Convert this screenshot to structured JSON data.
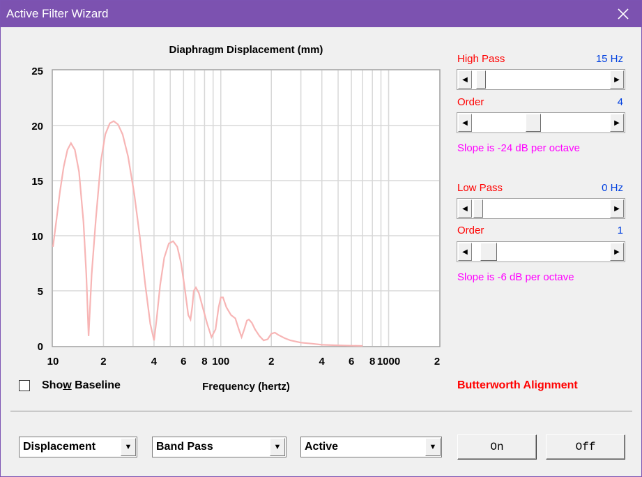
{
  "window": {
    "title": "Active Filter Wizard"
  },
  "chart_data": {
    "type": "line",
    "title": "Diaphragm Displacement (mm)",
    "xlabel": "Frequency (hertz)",
    "ylabel": "",
    "x_scale": "log",
    "xlim": [
      10,
      2000
    ],
    "ylim": [
      0,
      25
    ],
    "y_ticks": [
      0,
      5,
      10,
      15,
      20,
      25
    ],
    "x_tick_labels": [
      {
        "value": 10,
        "label": "10"
      },
      {
        "value": 20,
        "label": "2"
      },
      {
        "value": 40,
        "label": "4"
      },
      {
        "value": 60,
        "label": "6"
      },
      {
        "value": 80,
        "label": "8"
      },
      {
        "value": 100,
        "label": "100"
      },
      {
        "value": 200,
        "label": "2"
      },
      {
        "value": 400,
        "label": "4"
      },
      {
        "value": 600,
        "label": "6"
      },
      {
        "value": 800,
        "label": "8"
      },
      {
        "value": 1000,
        "label": "1000"
      },
      {
        "value": 2000,
        "label": "2"
      }
    ],
    "grid": true,
    "series": [
      {
        "color": "#f7b5b5",
        "x": [
          10,
          10.5,
          11,
          11.6,
          12.2,
          12.8,
          13.5,
          14.3,
          15.2,
          15.8,
          16.3,
          17,
          18,
          19.3,
          20.5,
          21.8,
          23,
          24.4,
          26,
          28,
          30.5,
          33,
          35.5,
          38,
          40,
          41.5,
          43.5,
          46,
          49,
          52,
          55,
          58,
          61,
          64,
          66,
          67.5,
          69,
          71,
          74,
          78,
          83,
          88,
          93,
          97,
          100,
          103,
          108,
          115,
          122,
          128,
          133,
          138,
          143,
          147,
          153,
          160,
          170,
          180,
          190,
          200,
          210,
          220,
          240,
          260,
          300,
          350,
          400,
          500,
          600,
          700
        ],
        "y": [
          9,
          11.5,
          14,
          16.3,
          17.8,
          18.4,
          17.8,
          15.8,
          11.2,
          6.5,
          0.9,
          6.5,
          11.5,
          16.8,
          19.2,
          20.2,
          20.4,
          20.1,
          19.2,
          17.2,
          13.8,
          9.8,
          5.5,
          2,
          0.5,
          2.5,
          5.5,
          8,
          9.3,
          9.5,
          9,
          7.5,
          5.2,
          2.8,
          2.4,
          3.5,
          5,
          5.3,
          4.8,
          3.5,
          2,
          0.8,
          1.5,
          3.5,
          4.4,
          4.4,
          3.5,
          2.8,
          2.5,
          1.5,
          0.8,
          1.5,
          2.3,
          2.4,
          2.1,
          1.5,
          0.9,
          0.5,
          0.6,
          1.1,
          1.2,
          1,
          0.7,
          0.5,
          0.3,
          0.2,
          0.1,
          0.05,
          0.02,
          0
        ]
      }
    ]
  },
  "high_pass": {
    "label": "High Pass",
    "value": "15 Hz",
    "position": 0.03
  },
  "high_pass_order": {
    "label": "Order",
    "value": "4",
    "position": 0.43
  },
  "high_slope": "Slope is -24 dB per octave",
  "low_pass": {
    "label": "Low Pass",
    "value": "0 Hz",
    "position": 0.01
  },
  "low_pass_order": {
    "label": "Order",
    "value": "1",
    "position": 0.07
  },
  "low_slope": "Slope is -6 dB per octave",
  "baseline": {
    "label_before": "Sho",
    "label_accel": "w",
    "label_after": " Baseline",
    "checked": false
  },
  "alignment": "Butterworth Alignment",
  "dropdowns": {
    "mode": "Displacement",
    "filter_type": "Band Pass",
    "filter_kind": "Active"
  },
  "buttons": {
    "on": "On",
    "off": "Off"
  }
}
